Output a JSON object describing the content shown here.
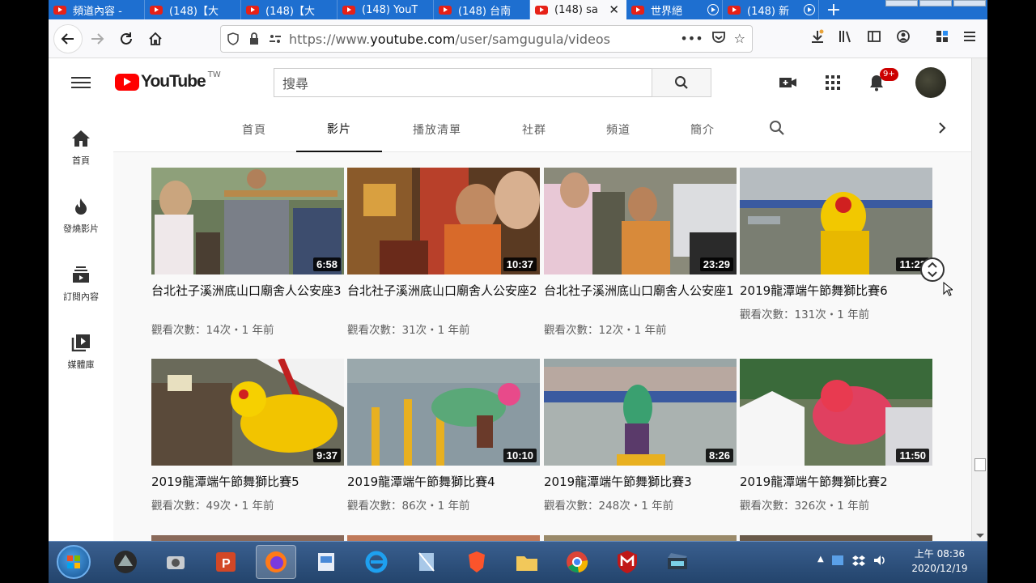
{
  "browser": {
    "tabs": [
      {
        "label": "頻道內容 -",
        "active": false
      },
      {
        "label": "(148)【大",
        "active": false
      },
      {
        "label": "(148)【大",
        "active": false
      },
      {
        "label": "(148) YouT",
        "active": false
      },
      {
        "label": "(148) 台南",
        "active": false
      },
      {
        "label": "(148) sa",
        "active": true
      },
      {
        "label": "世界絕",
        "active": false
      },
      {
        "label": "(148) 新",
        "active": false
      }
    ],
    "url_prefix": "https://www.",
    "url_domain": "youtube.com",
    "url_path": "/user/samgugula/videos"
  },
  "masthead": {
    "logo_text": "YouTube",
    "logo_region": "TW",
    "search_placeholder": "搜尋",
    "notification_count": "9+"
  },
  "guide": {
    "items": [
      {
        "label": "首頁",
        "icon": "home-icon"
      },
      {
        "label": "發燒影片",
        "icon": "fire-icon"
      },
      {
        "label": "訂閱內容",
        "icon": "subscriptions-icon"
      },
      {
        "label": "媒體庫",
        "icon": "library-icon"
      }
    ]
  },
  "channel_tabs": [
    {
      "label": "首頁",
      "active": false
    },
    {
      "label": "影片",
      "active": true
    },
    {
      "label": "播放清單",
      "active": false
    },
    {
      "label": "社群",
      "active": false
    },
    {
      "label": "頻道",
      "active": false
    },
    {
      "label": "簡介",
      "active": false
    }
  ],
  "videos": [
    {
      "title": "台北社子溪洲底山口廟舍人公安座3",
      "meta": "觀看次數：14次・1 年前",
      "duration": "6:58"
    },
    {
      "title": "台北社子溪洲底山口廟舍人公安座2",
      "meta": "觀看次數：31次・1 年前",
      "duration": "10:37"
    },
    {
      "title": "台北社子溪洲底山口廟舍人公安座1",
      "meta": "觀看次數：12次・1 年前",
      "duration": "23:29"
    },
    {
      "title": "2019龍潭端午節舞獅比賽6",
      "meta": "觀看次數：131次・1 年前",
      "duration": "11:22"
    },
    {
      "title": "2019龍潭端午節舞獅比賽5",
      "meta": "觀看次數：49次・1 年前",
      "duration": "9:37"
    },
    {
      "title": "2019龍潭端午節舞獅比賽4",
      "meta": "觀看次數：86次・1 年前",
      "duration": "10:10"
    },
    {
      "title": "2019龍潭端午節舞獅比賽3",
      "meta": "觀看次數：248次・1 年前",
      "duration": "8:26"
    },
    {
      "title": "2019龍潭端午節舞獅比賽2",
      "meta": "觀看次數：326次・1 年前",
      "duration": "11:50"
    }
  ],
  "taskbar": {
    "time": "上午 08:36",
    "date": "2020/12/19"
  },
  "colors": {
    "youtube_red": "#ff0000",
    "tabstrip_blue": "#1e6fd0",
    "badge_red": "#cc0000"
  }
}
